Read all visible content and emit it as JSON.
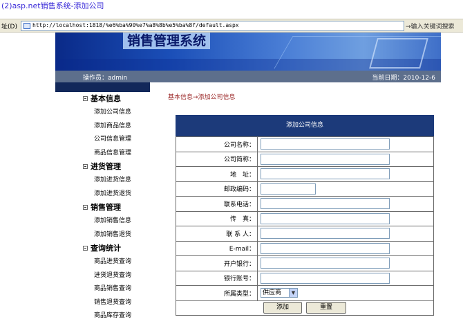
{
  "window": {
    "title": "(2)asp.net销售系统-添加公司"
  },
  "address": {
    "label": "址(D)",
    "url": "http://localhost:1818/%e6%ba%90%e7%a8%8b%e5%ba%8f/default.aspx",
    "search_hint": "→输入关键词搜索"
  },
  "header": {
    "system_title": "销售管理系统",
    "operator": "操作员：admin",
    "current_date": "当前日期：2010-12-6"
  },
  "sidebar": {
    "groups": [
      {
        "title": "基本信息",
        "items": [
          "添加公司信息",
          "添加商品信息",
          "公司信息管理",
          "商品信息管理"
        ]
      },
      {
        "title": "进货管理",
        "items": [
          "添加进货信息",
          "添加进货退货"
        ]
      },
      {
        "title": "销售管理",
        "items": [
          "添加销售信息",
          "添加销售退货"
        ]
      },
      {
        "title": "查询统计",
        "items": [
          "商品进货查询",
          "进货退货查询",
          "商品销售查询",
          "销售退货查询",
          "商品库存查询"
        ]
      }
    ]
  },
  "main": {
    "breadcrumb": "基本信息→添加公司信息",
    "form": {
      "title": "添加公司信息",
      "fields": [
        {
          "label": "公司名称："
        },
        {
          "label": "公司简称："
        },
        {
          "label": "地　址："
        },
        {
          "label": "邮政编码："
        },
        {
          "label": "联系电话："
        },
        {
          "label": "传　真："
        },
        {
          "label": "联 系 人："
        },
        {
          "label": "E-mail："
        },
        {
          "label": "开户银行："
        },
        {
          "label": "银行账号："
        },
        {
          "label": "所属类型：",
          "selected": "供应商"
        }
      ],
      "submit_label": "添加",
      "reset_label": "重置"
    }
  }
}
